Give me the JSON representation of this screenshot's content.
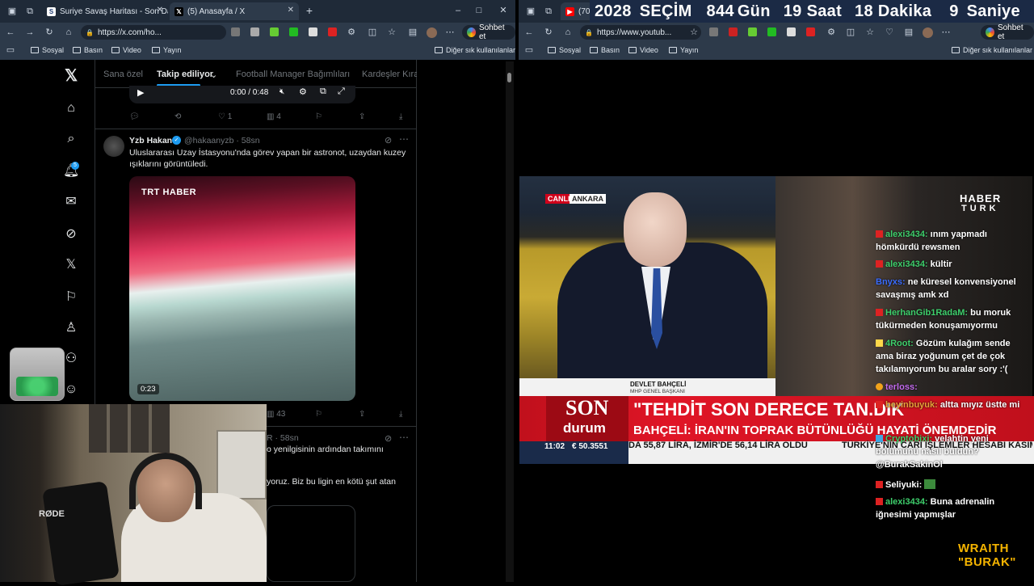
{
  "left": {
    "tabs": [
      {
        "label": "Suriye Savaş Haritası - Son Dakika"
      },
      {
        "label": "(5) Anasayfa / X"
      }
    ],
    "url": "https://x.com/ho...",
    "copilot_label": "Sohbet et",
    "bookmarks": [
      "Sosyal",
      "Basın",
      "Video",
      "Yayın"
    ],
    "other_bookmarks": "Diğer sık kullanılanlar",
    "x": {
      "tabs": [
        "Sana özel",
        "Takip ediliyor",
        "Football Manager Bağımlıları",
        "Kardeşler Kıra"
      ],
      "notif_count": "5",
      "video_time": "0:00 / 0:48",
      "actions1": {
        "likes": "1",
        "views": "4"
      },
      "tweet": {
        "name": "Yzb Hakan",
        "handle": "@hakaanyzb · 58sn",
        "text_line1": "Uluslararası Uzay İstasyonu'nda görev yapan bir astronot, uzaydan kuzey",
        "text_line2": "ışıklarını görüntüledi.",
        "media_logo": "TRT HABER",
        "media_duration": "0:23",
        "views": "43"
      },
      "tweet2": {
        "handle_tail": "R · 58sn",
        "line1": "o yenilgisinin ardından takımını",
        "line2": "yoruz. Biz bu ligin en kötü şut atan"
      }
    }
  },
  "right": {
    "tabs": [
      {
        "label": "(708"
      }
    ],
    "url": "https://www.youtub...",
    "copilot_label": "Sohbet et",
    "bookmarks": [
      "Sosyal",
      "Basın",
      "Video",
      "Yayın"
    ],
    "other_bookmarks": "Diğer sık kullanılanlar",
    "countdown": {
      "year": "2028",
      "label": "SEÇİM",
      "days": "844",
      "days_label": "Gün",
      "hours": "19",
      "hours_label": "Saat",
      "minutes": "18",
      "minutes_label": "Dakika",
      "seconds": "9",
      "seconds_label": "Saniye"
    },
    "news": {
      "live": "CANLI",
      "city": "ANKARA",
      "speaker": "DEVLET BAHÇELİ",
      "speaker_title": "MHP GENEL BAŞKANI",
      "son": "SON",
      "durum": "durum",
      "headline": "\"TEHDİT SON DERECE TAN.DIK",
      "subheadline": "BAHÇELİ: İRAN'IN TOPRAK BÜTÜNLÜĞÜ HAYATİ ÖNEMDEDİR",
      "clock": "11:02",
      "ticker_price": "€ 50.3551",
      "ticker": "DA 55,87 LİRA, İZMİR'DE 56,14 LİRA OLDU",
      "ticker2": "TÜRKİYE'NİN CARİ İŞLEMLER HESABI KASIM",
      "channel_line1": "HABER",
      "channel_line2": "TURK"
    },
    "chat": [
      {
        "user": "alexi3434:",
        "text": "ınım yapmadı hömkürdü rewsmen"
      },
      {
        "user": "alexi3434:",
        "text": "kültir"
      },
      {
        "user": "Bnyxs:",
        "text": "ne küresel konvensiyonel savaşmış amk xd"
      },
      {
        "user": "HerhanGib1RadaM:",
        "text": "bu moruk tükürmeden konuşamıyormu"
      },
      {
        "user": "4Root:",
        "text": "Gözüm kulağım sende ama biraz yoğunum çet de çok takılamıyorum bu aralar sory :'("
      },
      {
        "user": "terloss:",
        "text": ""
      },
      {
        "user": "beyinbuyuk:",
        "text": "altta mıyız üstte mi"
      },
      {
        "user": "Cryptobixi:",
        "text": "velahtin yeni bölümünü nasıl buldun? @BurakSakinOl"
      },
      {
        "user": "Seliyuki:",
        "text": ""
      },
      {
        "user": "alexi3434:",
        "text": "Buna adrenalin iğnesimi yapmışlar"
      }
    ],
    "logo_line1": "WRAITH",
    "logo_line2": "\"BURAK\""
  },
  "webcam": {
    "mic_brand": "RØDE"
  }
}
